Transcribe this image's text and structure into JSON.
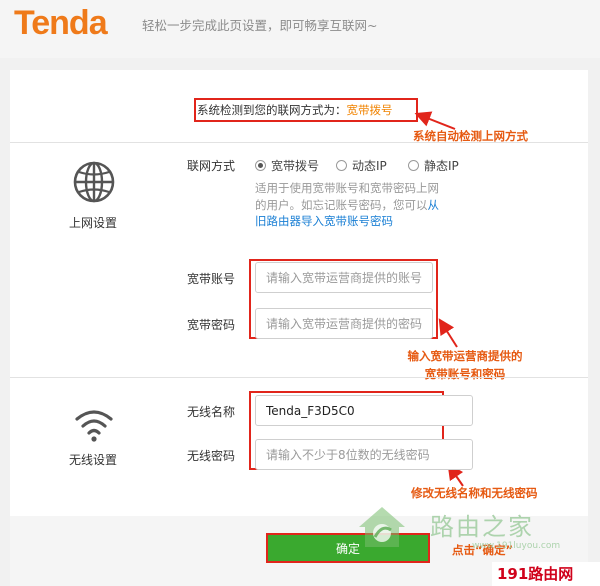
{
  "header": {
    "logo": "Tenda",
    "slogan": "轻松一步完成此页设置，即可畅享互联网~"
  },
  "detection": {
    "label": "系统检测到您的联网方式为：",
    "value": "宽带拨号"
  },
  "annotations": {
    "auto_detect": "系统自动检测上网方式",
    "account_line1": "输入宽带运营商提供的",
    "account_line2": "宽带账号和密码",
    "wireless": "修改无线名称和无线密码",
    "click": "点击“确定”"
  },
  "internet_settings": {
    "section_title": "上网设置",
    "connection_type_label": "联网方式",
    "options": [
      {
        "label": "宽带拨号",
        "checked": true
      },
      {
        "label": "动态IP",
        "checked": false
      },
      {
        "label": "静态IP",
        "checked": false
      }
    ],
    "hint_text": "适用于使用宽带账号和宽带密码上网的用户。如忘记账号密码，您可以",
    "hint_link": "从旧路由器导入宽带账号密码",
    "account": {
      "label": "宽带账号",
      "placeholder": "请输入宽带运营商提供的账号",
      "value": ""
    },
    "password": {
      "label": "宽带密码",
      "placeholder": "请输入宽带运营商提供的密码",
      "value": ""
    }
  },
  "wireless_settings": {
    "section_title": "无线设置",
    "ssid": {
      "label": "无线名称",
      "value": "Tenda_F3D5C0",
      "placeholder": ""
    },
    "password": {
      "label": "无线密码",
      "placeholder": "请输入不少于8位数的无线密码",
      "value": ""
    }
  },
  "confirm_button": "确定",
  "watermark": {
    "text": "路由之家",
    "url_text": "www.191luyou.com",
    "badge": "191路由网"
  },
  "colors": {
    "brand": "#ef7a1a",
    "annotation": "#e65a12",
    "highlight_box": "#e1251b",
    "confirm": "#3aa92f",
    "link": "#1a7fd4"
  },
  "icons": {
    "internet": "globe-icon",
    "wireless": "wifi-icon",
    "watermark": "house-logo-icon"
  }
}
